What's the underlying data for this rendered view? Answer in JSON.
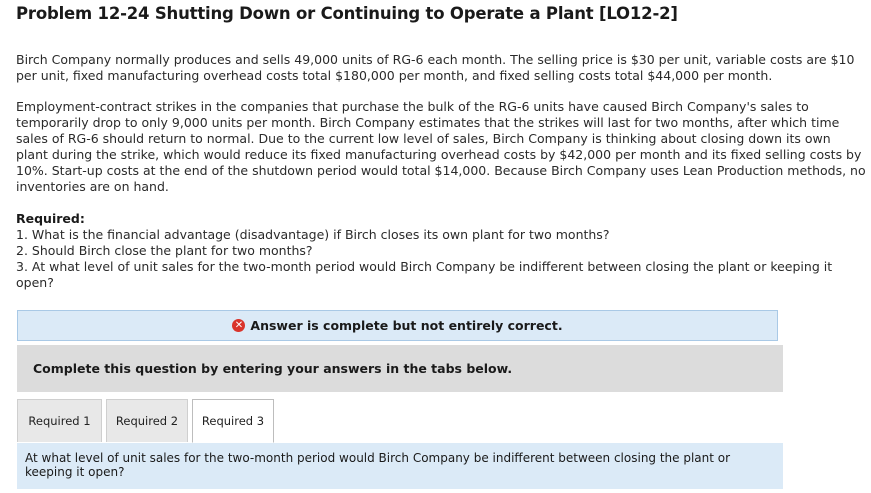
{
  "problem": {
    "title": "Problem 12-24 Shutting Down or Continuing to Operate a Plant [LO12-2]",
    "paragraph1": "Birch Company normally produces and sells 49,000 units of RG-6 each month. The selling price is $30 per unit, variable costs are $10 per unit, fixed manufacturing overhead costs total $180,000 per month, and fixed selling costs total $44,000 per month.",
    "paragraph2": "Employment-contract strikes in the companies that purchase the bulk of the RG-6 units have caused Birch Company's sales to temporarily drop to only 9,000 units per month. Birch Company estimates that the strikes will last for two months, after which time sales of RG-6 should return to normal. Due to the current low level of sales, Birch Company is thinking about closing down its own plant during the strike, which would reduce its fixed manufacturing overhead costs by $42,000 per month and its fixed selling costs by 10%. Start-up costs at the end of the shutdown period would total $14,000. Because Birch Company uses Lean Production methods, no inventories are on hand."
  },
  "required": {
    "heading": "Required:",
    "items": [
      "1. What is the financial advantage (disadvantage) if Birch closes its own plant for two months?",
      "2. Should Birch close the plant for two months?",
      "3. At what level of unit sales for the two-month period would Birch Company be indifferent between closing the plant or keeping it open?"
    ]
  },
  "answer_banner": {
    "icon": "x-circle-icon",
    "text": "Answer is complete but not entirely correct.",
    "icon_color": "#d9342b"
  },
  "instructions": "Complete this question by entering your answers in the tabs below.",
  "tabs": [
    {
      "label": "Required 1",
      "active": false
    },
    {
      "label": "Required 2",
      "active": false
    },
    {
      "label": "Required 3",
      "active": true
    }
  ],
  "active_question": "At what level of unit sales for the two-month period would Birch Company be indifferent between closing the plant or keeping it open?"
}
